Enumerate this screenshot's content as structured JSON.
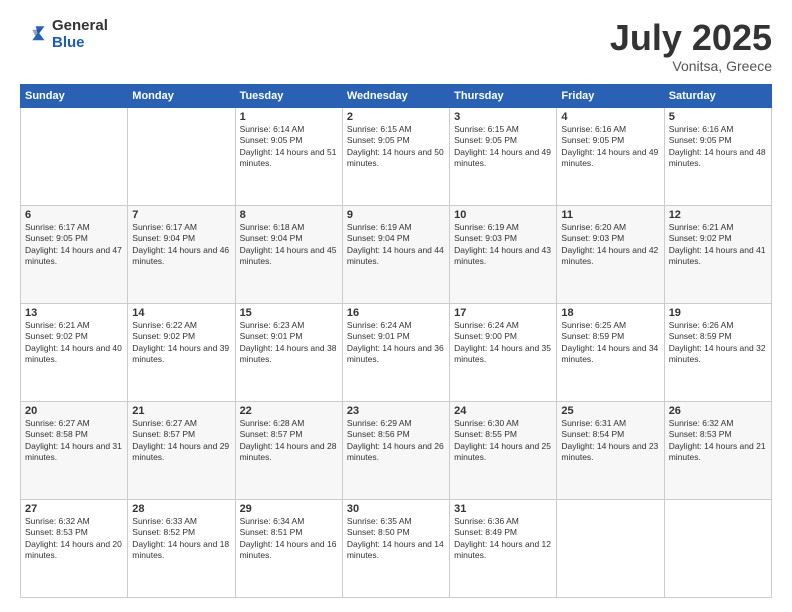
{
  "logo": {
    "general": "General",
    "blue": "Blue"
  },
  "header": {
    "month": "July 2025",
    "location": "Vonitsa, Greece"
  },
  "days_of_week": [
    "Sunday",
    "Monday",
    "Tuesday",
    "Wednesday",
    "Thursday",
    "Friday",
    "Saturday"
  ],
  "weeks": [
    [
      {
        "day": "",
        "info": ""
      },
      {
        "day": "",
        "info": ""
      },
      {
        "day": "1",
        "info": "Sunrise: 6:14 AM\nSunset: 9:05 PM\nDaylight: 14 hours and 51 minutes."
      },
      {
        "day": "2",
        "info": "Sunrise: 6:15 AM\nSunset: 9:05 PM\nDaylight: 14 hours and 50 minutes."
      },
      {
        "day": "3",
        "info": "Sunrise: 6:15 AM\nSunset: 9:05 PM\nDaylight: 14 hours and 49 minutes."
      },
      {
        "day": "4",
        "info": "Sunrise: 6:16 AM\nSunset: 9:05 PM\nDaylight: 14 hours and 49 minutes."
      },
      {
        "day": "5",
        "info": "Sunrise: 6:16 AM\nSunset: 9:05 PM\nDaylight: 14 hours and 48 minutes."
      }
    ],
    [
      {
        "day": "6",
        "info": "Sunrise: 6:17 AM\nSunset: 9:05 PM\nDaylight: 14 hours and 47 minutes."
      },
      {
        "day": "7",
        "info": "Sunrise: 6:17 AM\nSunset: 9:04 PM\nDaylight: 14 hours and 46 minutes."
      },
      {
        "day": "8",
        "info": "Sunrise: 6:18 AM\nSunset: 9:04 PM\nDaylight: 14 hours and 45 minutes."
      },
      {
        "day": "9",
        "info": "Sunrise: 6:19 AM\nSunset: 9:04 PM\nDaylight: 14 hours and 44 minutes."
      },
      {
        "day": "10",
        "info": "Sunrise: 6:19 AM\nSunset: 9:03 PM\nDaylight: 14 hours and 43 minutes."
      },
      {
        "day": "11",
        "info": "Sunrise: 6:20 AM\nSunset: 9:03 PM\nDaylight: 14 hours and 42 minutes."
      },
      {
        "day": "12",
        "info": "Sunrise: 6:21 AM\nSunset: 9:02 PM\nDaylight: 14 hours and 41 minutes."
      }
    ],
    [
      {
        "day": "13",
        "info": "Sunrise: 6:21 AM\nSunset: 9:02 PM\nDaylight: 14 hours and 40 minutes."
      },
      {
        "day": "14",
        "info": "Sunrise: 6:22 AM\nSunset: 9:02 PM\nDaylight: 14 hours and 39 minutes."
      },
      {
        "day": "15",
        "info": "Sunrise: 6:23 AM\nSunset: 9:01 PM\nDaylight: 14 hours and 38 minutes."
      },
      {
        "day": "16",
        "info": "Sunrise: 6:24 AM\nSunset: 9:01 PM\nDaylight: 14 hours and 36 minutes."
      },
      {
        "day": "17",
        "info": "Sunrise: 6:24 AM\nSunset: 9:00 PM\nDaylight: 14 hours and 35 minutes."
      },
      {
        "day": "18",
        "info": "Sunrise: 6:25 AM\nSunset: 8:59 PM\nDaylight: 14 hours and 34 minutes."
      },
      {
        "day": "19",
        "info": "Sunrise: 6:26 AM\nSunset: 8:59 PM\nDaylight: 14 hours and 32 minutes."
      }
    ],
    [
      {
        "day": "20",
        "info": "Sunrise: 6:27 AM\nSunset: 8:58 PM\nDaylight: 14 hours and 31 minutes."
      },
      {
        "day": "21",
        "info": "Sunrise: 6:27 AM\nSunset: 8:57 PM\nDaylight: 14 hours and 29 minutes."
      },
      {
        "day": "22",
        "info": "Sunrise: 6:28 AM\nSunset: 8:57 PM\nDaylight: 14 hours and 28 minutes."
      },
      {
        "day": "23",
        "info": "Sunrise: 6:29 AM\nSunset: 8:56 PM\nDaylight: 14 hours and 26 minutes."
      },
      {
        "day": "24",
        "info": "Sunrise: 6:30 AM\nSunset: 8:55 PM\nDaylight: 14 hours and 25 minutes."
      },
      {
        "day": "25",
        "info": "Sunrise: 6:31 AM\nSunset: 8:54 PM\nDaylight: 14 hours and 23 minutes."
      },
      {
        "day": "26",
        "info": "Sunrise: 6:32 AM\nSunset: 8:53 PM\nDaylight: 14 hours and 21 minutes."
      }
    ],
    [
      {
        "day": "27",
        "info": "Sunrise: 6:32 AM\nSunset: 8:53 PM\nDaylight: 14 hours and 20 minutes."
      },
      {
        "day": "28",
        "info": "Sunrise: 6:33 AM\nSunset: 8:52 PM\nDaylight: 14 hours and 18 minutes."
      },
      {
        "day": "29",
        "info": "Sunrise: 6:34 AM\nSunset: 8:51 PM\nDaylight: 14 hours and 16 minutes."
      },
      {
        "day": "30",
        "info": "Sunrise: 6:35 AM\nSunset: 8:50 PM\nDaylight: 14 hours and 14 minutes."
      },
      {
        "day": "31",
        "info": "Sunrise: 6:36 AM\nSunset: 8:49 PM\nDaylight: 14 hours and 12 minutes."
      },
      {
        "day": "",
        "info": ""
      },
      {
        "day": "",
        "info": ""
      }
    ]
  ]
}
